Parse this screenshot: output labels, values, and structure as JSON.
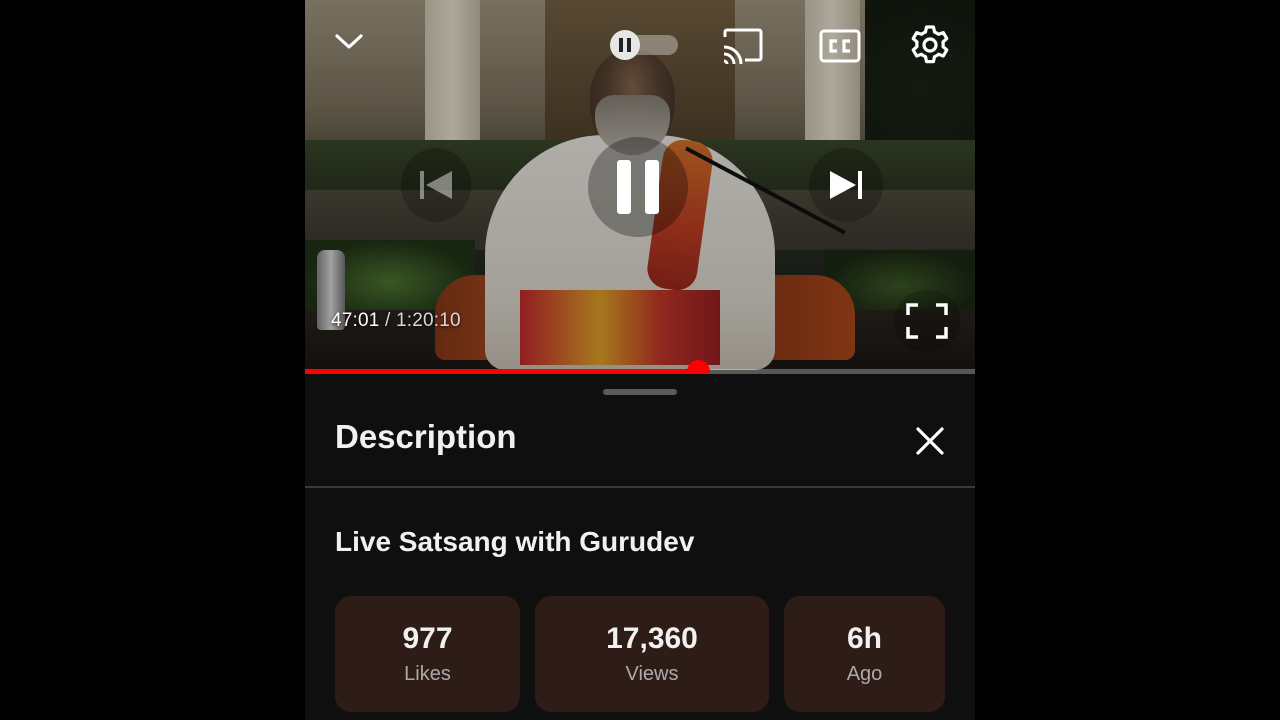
{
  "player": {
    "current_time": "47:01",
    "separator": "/",
    "duration": "1:20:10",
    "progress": 0.587,
    "autoplay_on": false,
    "accent_color": "#ff0000",
    "icons": {
      "collapse": "chevron-down-icon",
      "autoplay": "pause-icon",
      "cast": "cast-icon",
      "captions": "closed-captions-icon",
      "settings": "gear-icon",
      "previous": "skip-previous-icon",
      "play_pause": "pause-icon",
      "next": "skip-next-icon",
      "fullscreen": "fullscreen-icon"
    }
  },
  "description_panel": {
    "title": "Description",
    "close_icon": "close-icon",
    "video_title": "Live Satsang with Gurudev",
    "stats": [
      {
        "value": "977",
        "label": "Likes"
      },
      {
        "value": "17,360",
        "label": "Views"
      },
      {
        "value": "6h",
        "label": "Ago"
      }
    ],
    "stat_bg_color": "#2e1c16"
  }
}
